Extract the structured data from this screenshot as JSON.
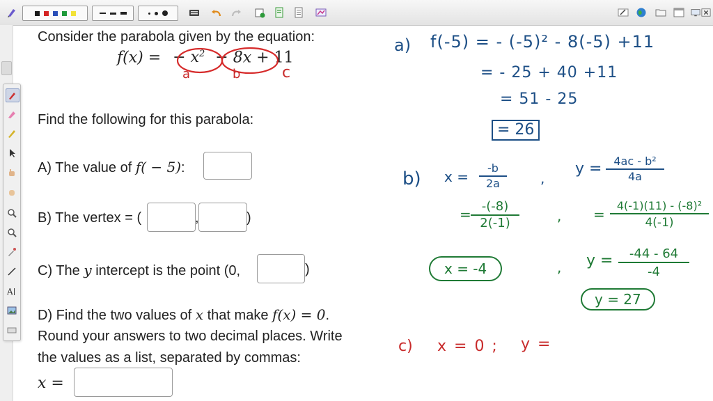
{
  "toolbar": {
    "colors": [
      "#1a1a1a",
      "#d42323",
      "#2a4fb8",
      "#1f9a3a",
      "#f2e238"
    ],
    "icons": [
      "pen-icon",
      "keyboard-icon",
      "undo-icon",
      "redo-icon",
      "new-page-icon",
      "insert-icon",
      "document-icon",
      "screenshot-icon",
      "draw-icon",
      "globe-icon",
      "folder-icon",
      "window-icon",
      "monitor-icon",
      "close-icon"
    ]
  },
  "tools": [
    "pen-icon",
    "highlighter-icon",
    "marker-icon",
    "select-icon",
    "hand-icon",
    "pan-icon",
    "zoom-in-icon",
    "zoom-out-icon",
    "eyedropper-icon",
    "line-icon",
    "text-icon",
    "image-icon",
    "keyboard-icon"
  ],
  "problem": {
    "intro": "Consider the parabola given by the equation:",
    "equation": {
      "lhs": "f(x) =",
      "t1": "− x",
      "t1sup": "2",
      "op1": "−",
      "t2": "8x",
      "op2": "+",
      "t3": "11"
    },
    "find": "Find the following for this parabola:",
    "qA": {
      "pre": "A) The value of ",
      "math": "f( − 5)",
      "post": ":"
    },
    "qB": {
      "pre": "B) The vertex = (",
      "comma": ",",
      "post": ")"
    },
    "qC": {
      "pre": "C) The ",
      "math": "y",
      "mid": " intercept is the point (0,",
      "post": ")"
    },
    "qD": {
      "line1_pre": "D) Find the two values of ",
      "line1_m1": "x",
      "line1_mid": " that make ",
      "line1_m2": "f(x) = 0",
      "line1_post": ".",
      "line2": "Round your answers to two decimal places. Write",
      "line3": "the values as a list, separated by commas:",
      "xlabel": "x ="
    }
  },
  "handwriting": {
    "label_a": "a",
    "label_b": "b",
    "label_c": "c",
    "part_a": {
      "label": "a)",
      "line1": "f(-5) =  - (-5)² - 8(-5) +11",
      "line2": "=  - 25 + 40 +11",
      "line3": "=  51 - 25",
      "answer": "= 26"
    },
    "part_b": {
      "label": "b)",
      "x_lhs": "x =",
      "x_num": "-b",
      "x_den": "2a",
      "comma1": ",",
      "y_lhs": "y =",
      "y_num": "4ac - b²",
      "y_den": "4a",
      "x_sub_eq": "=",
      "x_sub_num": "-(-8)",
      "x_sub_den": "2(-1)",
      "comma2": ",",
      "y_sub_eq": "=",
      "y_sub_num": "4(-1)(11) - (-8)²",
      "y_sub_den": "4(-1)",
      "x_answer": "x = -4",
      "comma3": ",",
      "y_eval_lhs": "y =",
      "y_eval_num": "-44 - 64",
      "y_eval_den": "-4",
      "y_answer": "y = 27"
    },
    "part_c": {
      "label": "c)",
      "work": "x = 0 ;",
      "y": "y ="
    }
  }
}
